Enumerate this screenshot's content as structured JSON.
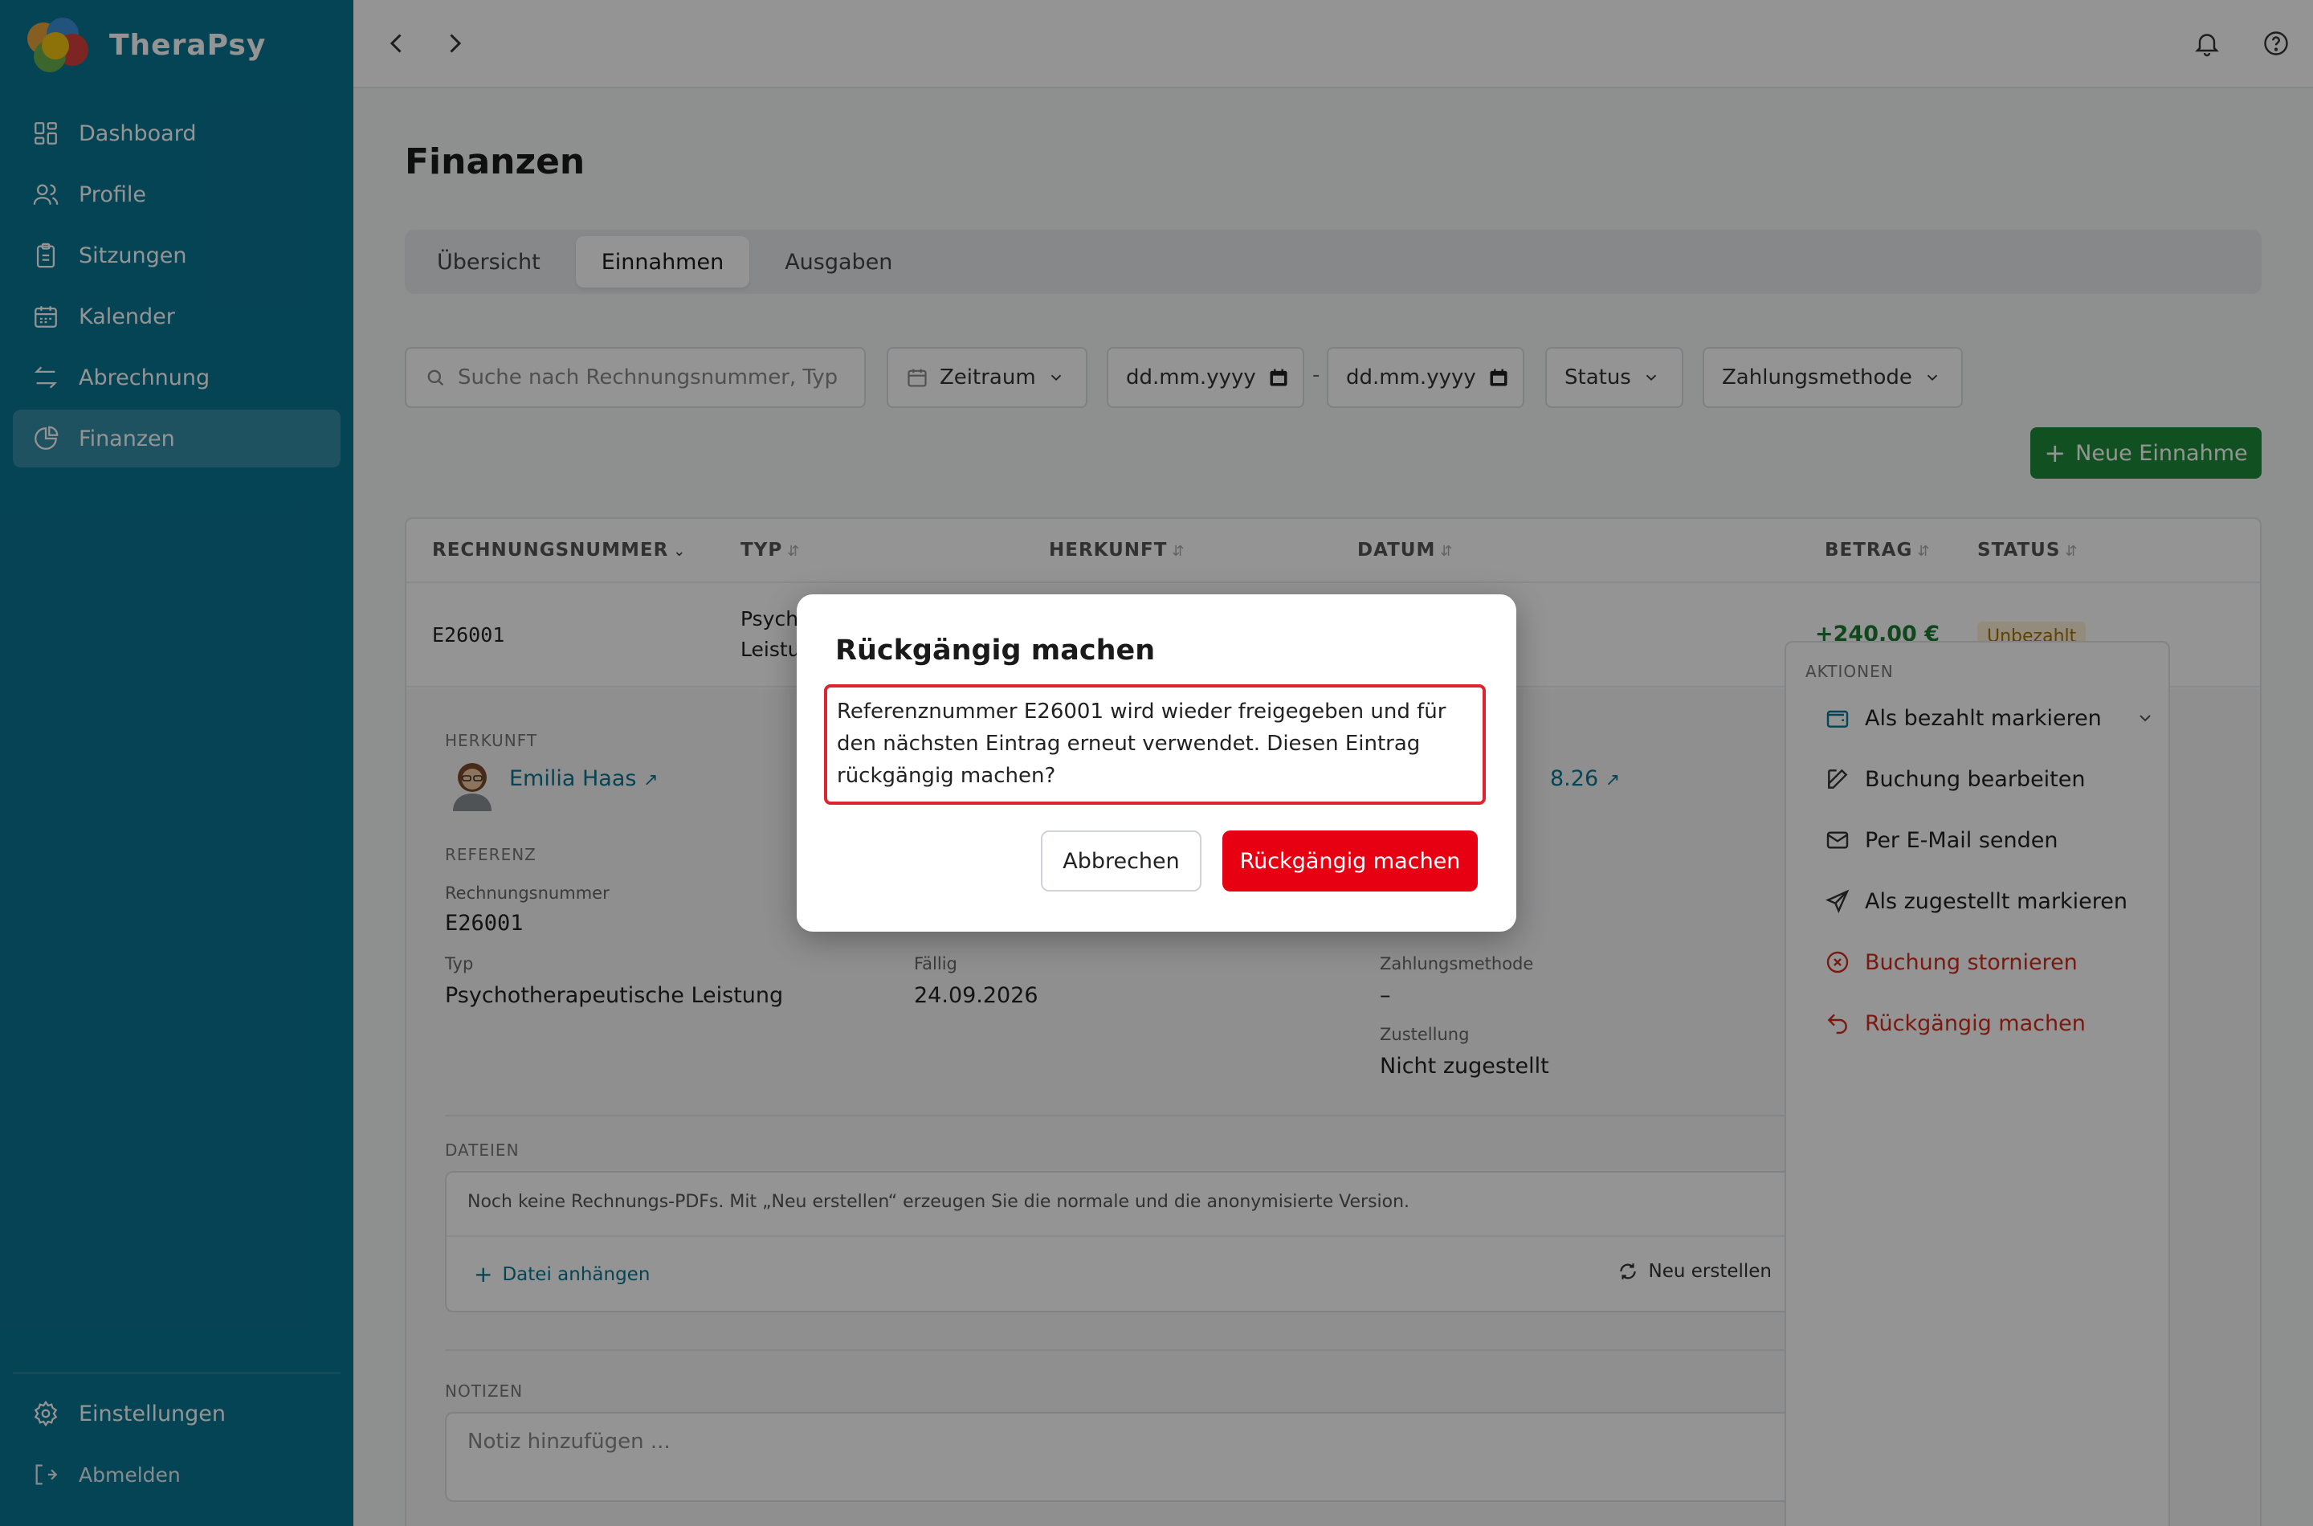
{
  "app": {
    "name": "TheraPsy"
  },
  "sidebar": {
    "items": [
      {
        "label": "Dashboard",
        "icon": "dashboard-icon"
      },
      {
        "label": "Profile",
        "icon": "users-icon"
      },
      {
        "label": "Sitzungen",
        "icon": "clipboard-icon"
      },
      {
        "label": "Kalender",
        "icon": "calendar-icon"
      },
      {
        "label": "Abrechnung",
        "icon": "arrows-icon"
      },
      {
        "label": "Finanzen",
        "icon": "pie-chart-icon",
        "active": true
      }
    ],
    "settings_label": "Einstellungen",
    "logout_label": "Abmelden"
  },
  "page": {
    "title": "Finanzen"
  },
  "tabs": [
    {
      "label": "Übersicht"
    },
    {
      "label": "Einnahmen",
      "active": true
    },
    {
      "label": "Ausgaben"
    }
  ],
  "filters": {
    "search_placeholder": "Suche nach Rechnungsnummer, Typ",
    "zeitraum_label": "Zeitraum",
    "date_from_placeholder": "dd.mm.yyyy",
    "date_to_placeholder": "dd.mm.yyyy",
    "date_separator": "-",
    "status_label": "Status",
    "payment_label": "Zahlungsmethode"
  },
  "new_button_label": "Neue Einnahme",
  "table": {
    "columns": [
      "RECHNUNGSNUMMER",
      "TYP",
      "HERKUNFT",
      "DATUM",
      "BETRAG",
      "STATUS"
    ],
    "row": {
      "number": "E26001",
      "type_line1": "Psych",
      "type_line2": "Leistu",
      "amount": "+240,00 €",
      "status": "Unbezahlt"
    }
  },
  "detail": {
    "herkunft_label": "HERKUNFT",
    "client_name": "Emilia Haas",
    "date_partial": "8.26",
    "referenz_label": "REFERENZ",
    "rechnungsnummer_label": "Rechnungsnummer",
    "rechnungsnummer_value": "E26001",
    "typ_label": "Typ",
    "typ_value": "Psychotherapeutische Leistung",
    "faellig_label": "Fällig",
    "faellig_value": "24.09.2026",
    "zahlungsmethode_label": "Zahlungsmethode",
    "zahlungsmethode_value": "–",
    "zustellung_label": "Zustellung",
    "zustellung_value": "Nicht zugestellt",
    "dateien_label": "DATEIEN",
    "dateien_message": "Noch keine Rechnungs-PDFs. Mit „Neu erstellen“ erzeugen Sie die normale und die anonymisierte Version.",
    "attach_label": "Datei anhängen",
    "regen_label": "Neu erstellen",
    "notizen_label": "NOTIZEN",
    "note_placeholder": "Notiz hinzufügen ..."
  },
  "actions": {
    "title": "AKTIONEN",
    "items": [
      {
        "label": "Als bezahlt markieren"
      },
      {
        "label": "Buchung bearbeiten"
      },
      {
        "label": "Per E-Mail senden"
      },
      {
        "label": "Als zugestellt markieren"
      },
      {
        "label": "Buchung stornieren"
      },
      {
        "label": "Rückgängig machen"
      }
    ]
  },
  "modal": {
    "title": "Rückgängig machen",
    "text": "Referenznummer E26001 wird wieder freigegeben und für den nächsten Eintrag erneut verwendet. Diesen Eintrag rückgängig machen?",
    "cancel_label": "Abbrechen",
    "confirm_label": "Rückgängig machen"
  },
  "colors": {
    "sidebar": "#0a7592",
    "primary_green": "#1e8c3a",
    "danger": "#e60012",
    "highlight_border": "#e0242f"
  }
}
